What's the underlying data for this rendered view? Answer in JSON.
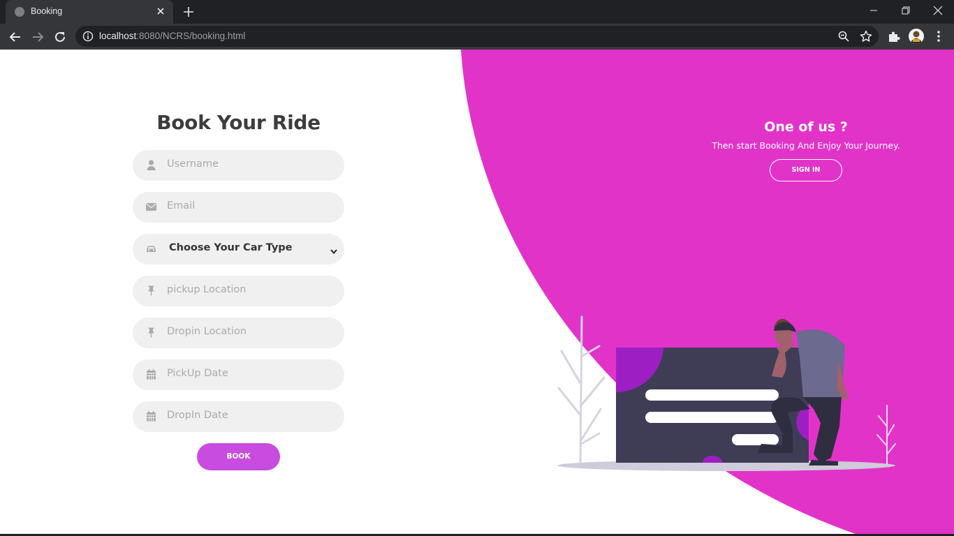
{
  "browser": {
    "tab_title": "Booking",
    "url_host": "localhost",
    "url_rest": ":8080/NCRS/booking.html"
  },
  "form": {
    "title": "Book Your Ride",
    "username_placeholder": "Username",
    "email_placeholder": "Email",
    "car_type_selected": "Choose Your Car Type",
    "pickup_location_placeholder": "pickup Location",
    "dropin_location_placeholder": "Dropin Location",
    "pickup_date_placeholder": "PickUp Date",
    "dropin_date_placeholder": "DropIn Date",
    "book_label": "BOOK"
  },
  "panel": {
    "title": "One of us ?",
    "subtitle": "Then start Booking And Enjoy Your Journey.",
    "signin_label": "SIGN IN"
  },
  "colors": {
    "accent_pink": "#e233c8",
    "button_purple": "#c94ce0",
    "field_bg": "#f0f0f0",
    "title_text": "#3d3d3d"
  },
  "icons": {
    "username": "user-icon",
    "email": "envelope-icon",
    "car": "car-icon",
    "pickup": "pin-icon",
    "dropin": "pin-icon",
    "pickup_date": "calendar-icon",
    "dropin_date": "calendar-icon"
  }
}
